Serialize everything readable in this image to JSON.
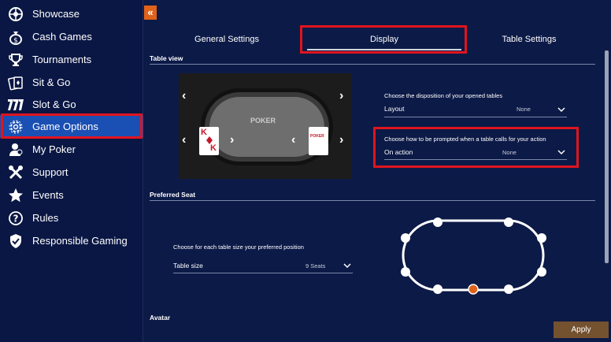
{
  "sidebar": {
    "items": [
      {
        "label": "Showcase",
        "icon": "roulette-icon",
        "active": false
      },
      {
        "label": "Cash Games",
        "icon": "money-bag-icon",
        "active": false
      },
      {
        "label": "Tournaments",
        "icon": "trophy-icon",
        "active": false
      },
      {
        "label": "Sit & Go",
        "icon": "cards-icon",
        "active": false
      },
      {
        "label": "Slot & Go",
        "icon": "777-icon",
        "active": false
      },
      {
        "label": "Game Options",
        "icon": "gear-icon",
        "active": true
      },
      {
        "label": "My Poker",
        "icon": "user-icon",
        "active": false
      },
      {
        "label": "Support",
        "icon": "tools-icon",
        "active": false
      },
      {
        "label": "Events",
        "icon": "star-icon",
        "active": false
      },
      {
        "label": "Rules",
        "icon": "question-icon",
        "active": false
      },
      {
        "label": "Responsible Gaming",
        "icon": "shield-icon",
        "active": false
      }
    ],
    "active_color": "#1a4fb3"
  },
  "header": {
    "collapse_glyph": "«"
  },
  "tabs": [
    {
      "label": "General Settings",
      "active": false
    },
    {
      "label": "Display",
      "active": true
    },
    {
      "label": "Table Settings",
      "active": false
    }
  ],
  "sections": {
    "table_view": "Table view",
    "preferred_seat": "Preferred Seat",
    "avatar": "Avatar"
  },
  "preview": {
    "logo": "POKER",
    "card_rank": "K"
  },
  "layout_field": {
    "description": "Choose the disposition of your opened tables",
    "name": "Layout",
    "value": "None"
  },
  "action_field": {
    "description": "Choose how to be prompted when a table calls for your action",
    "name": "On action",
    "value": "None"
  },
  "seat_field": {
    "description": "Choose for each table size your preferred position",
    "name": "Table size",
    "value": "9 Seats"
  },
  "apply_label": "Apply",
  "colors": {
    "background": "#0c1a47",
    "highlight": "#e0141e",
    "accent_orange": "#e0621a",
    "apply": "#74512f",
    "selected_seat": "#e0621a"
  }
}
